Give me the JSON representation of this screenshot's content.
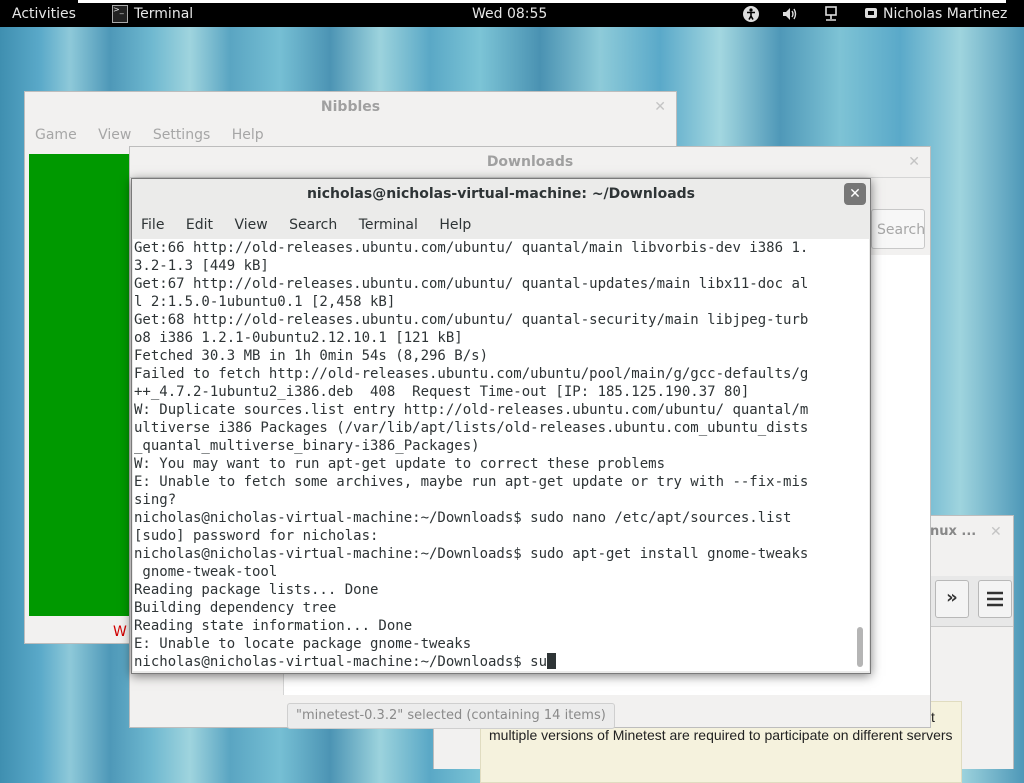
{
  "topbar": {
    "activities": "Activities",
    "app_name": "Terminal",
    "app_icon_text": ">_",
    "clock": "Wed 08:55",
    "user": "Nicholas Martinez"
  },
  "nibbles": {
    "title": "Nibbles",
    "menu": [
      "Game",
      "View",
      "Settings",
      "Help"
    ],
    "status_fragment": "W"
  },
  "downloads": {
    "title": "Downloads",
    "search_label": "Search",
    "status": "\"minetest-0.3.2\" selected (containing 14 items)"
  },
  "browser": {
    "title_fragment": "nux ...",
    "forward_icon": "»",
    "paragraph": "After looking through the server section of the forums it would seem that multiple versions of Minetest are required to participate on different servers"
  },
  "terminal": {
    "title": "nicholas@nicholas-virtual-machine: ~/Downloads",
    "menu": [
      "File",
      "Edit",
      "View",
      "Search",
      "Terminal",
      "Help"
    ],
    "lines": [
      "Get:66 http://old-releases.ubuntu.com/ubuntu/ quantal/main libvorbis-dev i386 1.",
      "3.2-1.3 [449 kB]",
      "Get:67 http://old-releases.ubuntu.com/ubuntu/ quantal-updates/main libx11-doc al",
      "l 2:1.5.0-1ubuntu0.1 [2,458 kB]",
      "Get:68 http://old-releases.ubuntu.com/ubuntu/ quantal-security/main libjpeg-turb",
      "o8 i386 1.2.1-0ubuntu2.12.10.1 [121 kB]",
      "Fetched 30.3 MB in 1h 0min 54s (8,296 B/s)",
      "Failed to fetch http://old-releases.ubuntu.com/ubuntu/pool/main/g/gcc-defaults/g",
      "++_4.7.2-1ubuntu2_i386.deb  408  Request Time-out [IP: 185.125.190.37 80]",
      "W: Duplicate sources.list entry http://old-releases.ubuntu.com/ubuntu/ quantal/m",
      "ultiverse i386 Packages (/var/lib/apt/lists/old-releases.ubuntu.com_ubuntu_dists",
      "_quantal_multiverse_binary-i386_Packages)",
      "W: You may want to run apt-get update to correct these problems",
      "E: Unable to fetch some archives, maybe run apt-get update or try with --fix-mis",
      "sing?",
      "nicholas@nicholas-virtual-machine:~/Downloads$ sudo nano /etc/apt/sources.list",
      "[sudo] password for nicholas:",
      "nicholas@nicholas-virtual-machine:~/Downloads$ sudo apt-get install gnome-tweaks",
      " gnome-tweak-tool",
      "Reading package lists... Done",
      "Building dependency tree",
      "Reading state information... Done",
      "E: Unable to locate package gnome-tweaks"
    ],
    "prompt_line": "nicholas@nicholas-virtual-machine:~/Downloads$ su"
  }
}
